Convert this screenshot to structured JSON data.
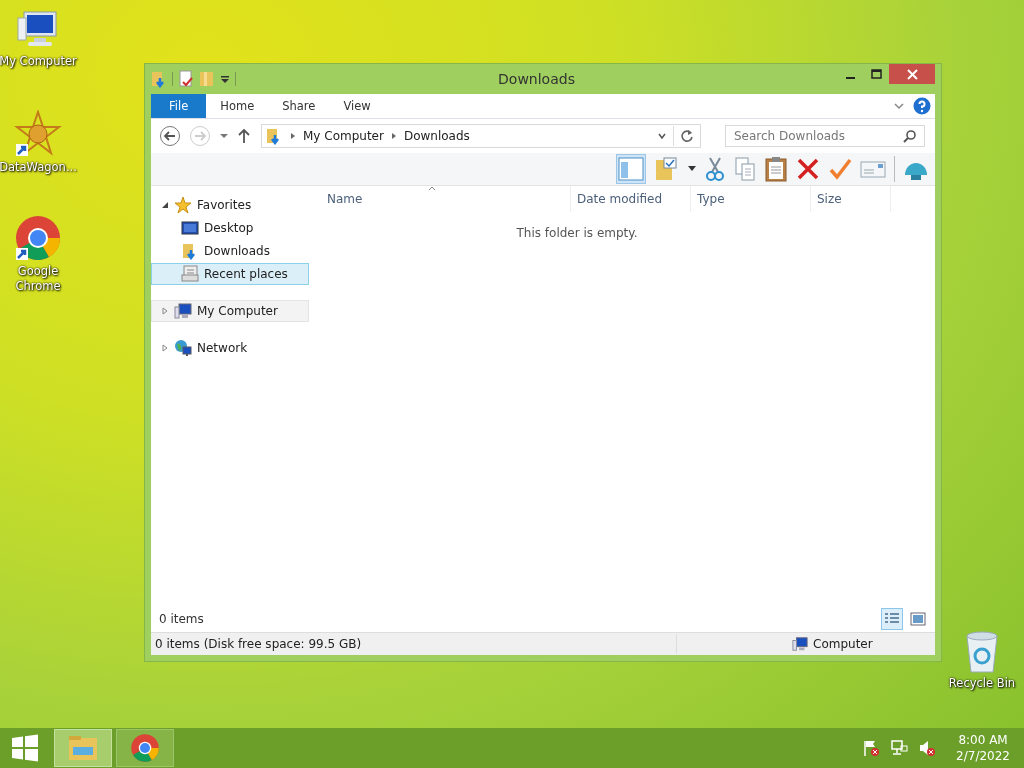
{
  "desktop_icons": [
    {
      "label": "My Computer",
      "kind": "computer"
    },
    {
      "label": "DataWagon...",
      "kind": "star"
    },
    {
      "label": "Google Chrome",
      "kind": "chrome"
    },
    {
      "label": "Recycle Bin",
      "kind": "bin"
    }
  ],
  "window": {
    "title": "Downloads",
    "ribbon_tabs": [
      {
        "label": "File",
        "selected": true
      },
      {
        "label": "Home",
        "selected": false
      },
      {
        "label": "Share",
        "selected": false
      },
      {
        "label": "View",
        "selected": false
      }
    ],
    "address": [
      "My Computer",
      "Downloads"
    ],
    "search": {
      "placeholder": "Search Downloads"
    },
    "nav_pane": [
      {
        "label": "Favorites",
        "kind": "star",
        "expanded": true,
        "selected": false,
        "hovered": false,
        "children": [
          {
            "label": "Desktop",
            "kind": "desktop",
            "selected": false,
            "hovered": false
          },
          {
            "label": "Downloads",
            "kind": "downloads",
            "selected": false,
            "hovered": false
          },
          {
            "label": "Recent places",
            "kind": "recent",
            "selected": true,
            "hovered": false
          }
        ]
      },
      {
        "label": "My Computer",
        "kind": "computer",
        "expanded": false,
        "selected": false,
        "hovered": true
      },
      {
        "label": "Network",
        "kind": "network",
        "expanded": false,
        "selected": false,
        "hovered": false
      }
    ],
    "columns": [
      "Name",
      "Date modified",
      "Type",
      "Size"
    ],
    "empty_message": "This folder is empty.",
    "item_count": "0 items",
    "view_buttons": [
      {
        "kind": "details",
        "selected": true
      },
      {
        "kind": "thumbnails",
        "selected": false
      }
    ],
    "status_bar": {
      "text": "0 items (Disk free space: 99.5 GB)",
      "location": "Computer"
    }
  },
  "taskbar": {
    "apps": [
      {
        "kind": "explorer",
        "selected": true
      },
      {
        "kind": "chrome",
        "selected": false
      }
    ],
    "time": "8:00 AM",
    "date": "2/7/2022"
  }
}
